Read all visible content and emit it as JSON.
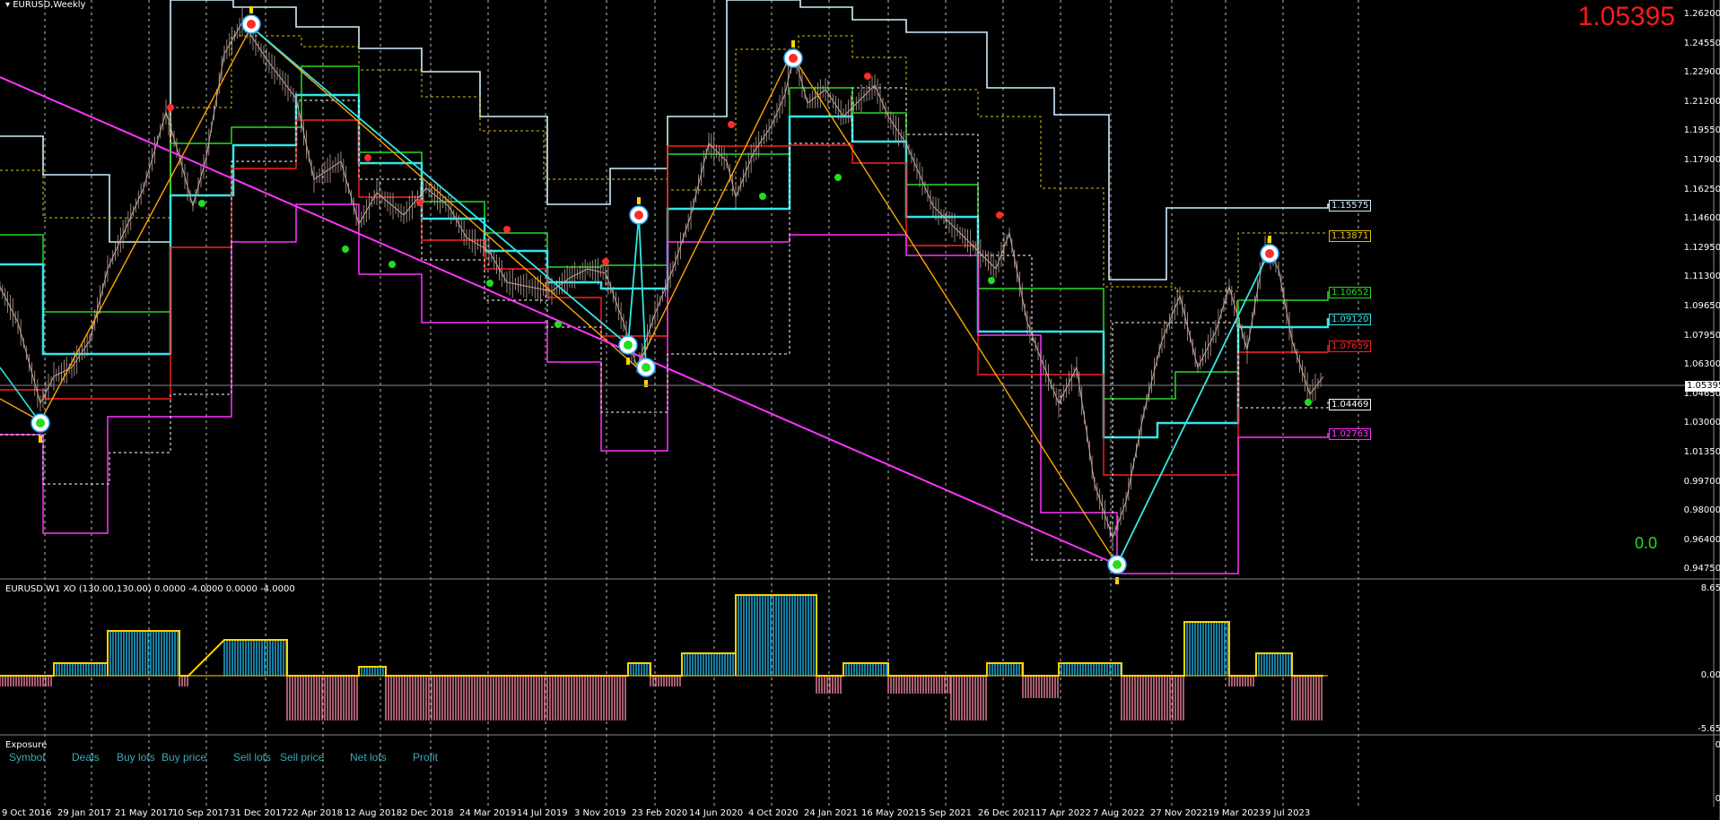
{
  "window": {
    "title": "EURUSD,Weekly"
  },
  "bid_price_display": "1.05395",
  "corner_value": "0.0",
  "price_axis_ticks": [
    "1.26200",
    "1.24550",
    "1.22900",
    "1.21200",
    "1.19550",
    "1.17900",
    "1.16250",
    "1.14600",
    "1.12950",
    "1.11300",
    "1.09650",
    "1.07950",
    "1.06300",
    "1.04650",
    "1.03000",
    "1.01350",
    "0.99700",
    "0.98000",
    "0.96400",
    "0.94750"
  ],
  "current_price_tag": "1.05395",
  "level_tags": [
    {
      "text": "1.15575",
      "color": "#cfefff"
    },
    {
      "text": "1.13871",
      "color": "#e0c000"
    },
    {
      "text": "1.10652",
      "color": "#22dd22"
    },
    {
      "text": "1.09120",
      "color": "#33e6e6"
    },
    {
      "text": "1.07659",
      "color": "#ff2020"
    },
    {
      "text": "1.04469",
      "color": "#ffffff"
    },
    {
      "text": "1.02763",
      "color": "#ff33ff"
    }
  ],
  "indicator": {
    "title": "EURUSD W1 XO (130.00,130.00) 0.0000 -4.0000 0.0000 -4.0000",
    "axis_ticks": [
      "8.65",
      "0.00",
      "-5.65"
    ]
  },
  "exposure": {
    "title": "Exposure",
    "columns": [
      "Symbol",
      "Deals",
      "Buy lots",
      "Buy price",
      "Sell lots",
      "Sell price",
      "Net lots",
      "Profit"
    ],
    "axis_ticks": [
      "0",
      "0"
    ]
  },
  "time_axis": [
    "9 Oct 2016",
    "29 Jan 2017",
    "21 May 2017",
    "10 Sep 2017",
    "31 Dec 2017",
    "22 Apr 2018",
    "12 Aug 2018",
    "2 Dec 2018",
    "24 Mar 2019",
    "14 Jul 2019",
    "3 Nov 2019",
    "23 Feb 2020",
    "14 Jun 2020",
    "4 Oct 2020",
    "24 Jan 2021",
    "16 May 2021",
    "5 Sep 2021",
    "26 Dec 2021",
    "17 Apr 2022",
    "7 Aug 2022",
    "27 Nov 2022",
    "19 Mar 2023",
    "9 Jul 2023"
  ],
  "colors": {
    "background": "#000000",
    "price_line": "#bfa59a",
    "grid": "#bbbbbb",
    "upper": "#cfefff",
    "dotted_upper": "#e0c000",
    "green": "#22dd22",
    "cyan": "#33e6e6",
    "red": "#ff2020",
    "magenta": "#ff33ff",
    "zigzag": "#ffa500",
    "hist_up": "#1fa8d8",
    "hist_down": "#e07a94",
    "outline": "#ffd400"
  }
}
